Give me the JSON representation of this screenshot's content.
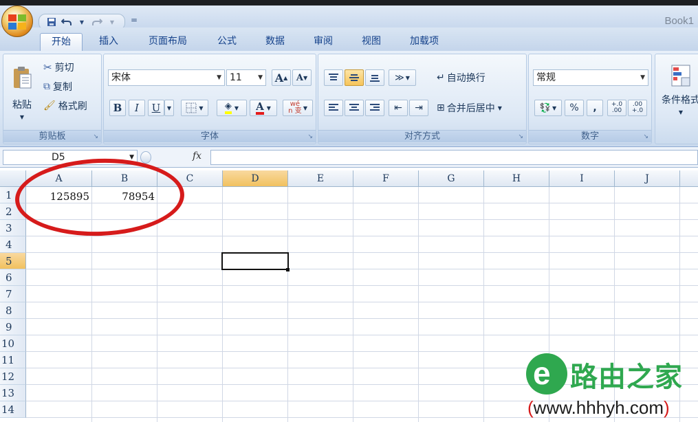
{
  "window": {
    "title": "Book1"
  },
  "qat": {
    "more": "="
  },
  "tabs": [
    "开始",
    "插入",
    "页面布局",
    "公式",
    "数据",
    "审阅",
    "视图",
    "加载项"
  ],
  "clipboard": {
    "paste": "粘贴",
    "cut": "剪切",
    "copy": "复制",
    "format_painter": "格式刷",
    "label": "剪贴板"
  },
  "font": {
    "name": "宋体",
    "size": "11",
    "bold": "B",
    "italic": "I",
    "underline": "U",
    "grow": "A",
    "shrink": "A",
    "color_a": "A",
    "phonetic": "wén 变",
    "label": "字体"
  },
  "alignment": {
    "wrap": "自动换行",
    "merge": "合并后居中",
    "label": "对齐方式"
  },
  "number": {
    "format": "常规",
    "percent": "%",
    "comma": ",",
    "inc_decimal": "+.0 .00",
    "dec_decimal": ".00 +.0",
    "label": "数字"
  },
  "styles": {
    "conditional": "条件格式"
  },
  "formula_bar": {
    "name_box": "D5",
    "fx": "fx",
    "value": ""
  },
  "sheet": {
    "columns": [
      "A",
      "B",
      "C",
      "D",
      "E",
      "F",
      "G",
      "H",
      "I",
      "J"
    ],
    "rows": [
      "1",
      "2",
      "3",
      "4",
      "5",
      "6",
      "7",
      "8",
      "9",
      "10",
      "11",
      "12",
      "13",
      "14"
    ],
    "selected_column": "D",
    "selected_row": "5",
    "cells": {
      "A1": "125895",
      "B1": "78954"
    }
  },
  "watermark": {
    "logo_letter": "e",
    "title": "路由之家",
    "url": "www.hhhyh.com",
    "paren_open": "(",
    "paren_close": ")"
  },
  "colors": {
    "annotation_red": "#d61b1b",
    "watermark_green": "#2fa84f",
    "selection_orange": "#f1c15f"
  }
}
